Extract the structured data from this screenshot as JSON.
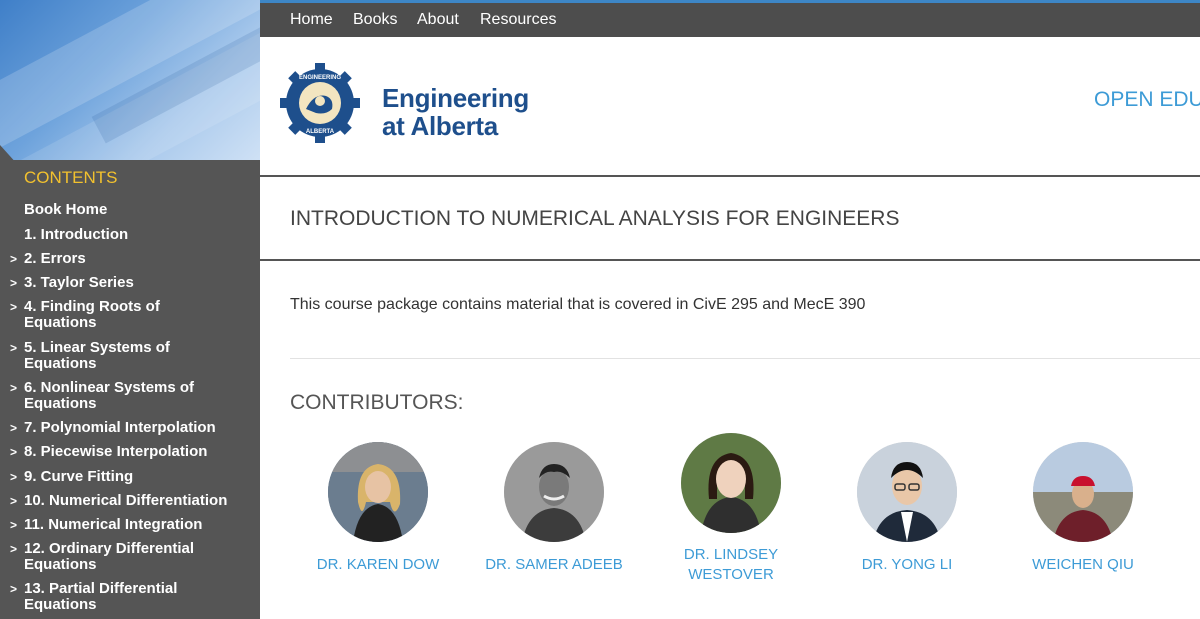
{
  "nav": {
    "links": [
      "Home",
      "Books",
      "About",
      "Resources"
    ]
  },
  "sidebar": {
    "heading": "CONTENTS",
    "items": [
      {
        "label": "Book Home",
        "arrow": ""
      },
      {
        "label": "1. Introduction",
        "arrow": ""
      },
      {
        "label": "2. Errors",
        "arrow": ">"
      },
      {
        "label": "3. Taylor Series",
        "arrow": ">"
      },
      {
        "label": "4. Finding Roots of Equations",
        "arrow": ">"
      },
      {
        "label": "5. Linear Systems of Equations",
        "arrow": ">"
      },
      {
        "label": "6. Nonlinear Systems of Equations",
        "arrow": ">"
      },
      {
        "label": "7. Polynomial Interpolation",
        "arrow": ">"
      },
      {
        "label": "8. Piecewise Interpolation",
        "arrow": ">"
      },
      {
        "label": "9. Curve Fitting",
        "arrow": ">"
      },
      {
        "label": "10. Numerical Differentiation",
        "arrow": ">"
      },
      {
        "label": "11. Numerical Integration",
        "arrow": ">"
      },
      {
        "label": "12. Ordinary Differential Equations",
        "arrow": ">"
      },
      {
        "label": "13. Partial Differential Equations",
        "arrow": ">"
      }
    ]
  },
  "header": {
    "logo_badge_top": "ENGINEERING",
    "logo_badge_bottom": "ALBERTA",
    "logo_line1": "Engineering",
    "logo_line2": "at Alberta",
    "open_edu": "OPEN EDU"
  },
  "main": {
    "title": "INTRODUCTION TO NUMERICAL ANALYSIS FOR ENGINEERS",
    "description": "This course package contains material that is covered in CivE 295 and MecE 390",
    "contributors_heading": "CONTRIBUTORS:",
    "contributors": [
      {
        "name_line1": "DR. KAREN DOW",
        "name_line2": ""
      },
      {
        "name_line1": "DR. SAMER ADEEB",
        "name_line2": ""
      },
      {
        "name_line1": "DR. LINDSEY",
        "name_line2": "WESTOVER"
      },
      {
        "name_line1": "DR. YONG LI",
        "name_line2": ""
      },
      {
        "name_line1": "WEICHEN QIU",
        "name_line2": ""
      }
    ]
  },
  "colors": {
    "sidebar_bg": "#555555",
    "contents_heading": "#f2c12e",
    "nav_bg": "#4d4d4d",
    "link_blue": "#3d9bd6",
    "logo_blue": "#1e4f8c"
  }
}
